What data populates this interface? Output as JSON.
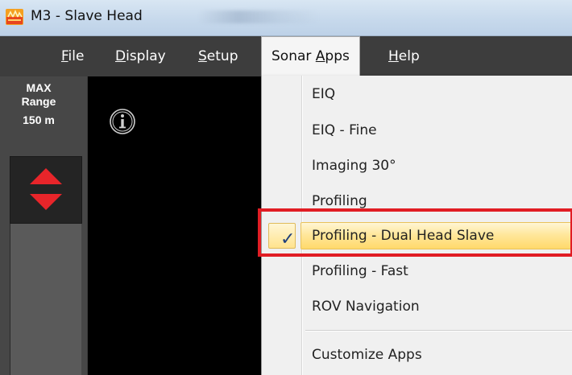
{
  "window": {
    "title": "M3 - Slave Head"
  },
  "menubar": {
    "items": [
      {
        "pre": "",
        "u": "F",
        "post": "ile"
      },
      {
        "pre": "",
        "u": "D",
        "post": "isplay"
      },
      {
        "pre": "",
        "u": "S",
        "post": "etup"
      },
      {
        "pre": "Sonar ",
        "u": "A",
        "post": "pps"
      },
      {
        "pre": "",
        "u": "H",
        "post": "elp"
      }
    ]
  },
  "left_panel": {
    "range_label_1": "MAX",
    "range_label_2": "Range",
    "range_value": "150  m"
  },
  "dropdown": {
    "items": [
      "EIQ",
      "EIQ - Fine",
      "Imaging 30°",
      "Profiling",
      "Profiling - Dual Head Slave",
      "Profiling - Fast",
      "ROV Navigation",
      "Customize Apps"
    ],
    "selected_index": 4,
    "check_glyph": "✓"
  },
  "colors": {
    "titlebar": "#c7d9ec",
    "menubar": "#3d3d3d",
    "highlight": "#ffe79c",
    "annotation_box": "#e11d24",
    "range_arrow": "#e8252a"
  },
  "icons": {
    "app": "app-logo-icon",
    "info": "info-icon",
    "range": "range-up-down-arrows-icon",
    "check": "checkmark-icon"
  }
}
